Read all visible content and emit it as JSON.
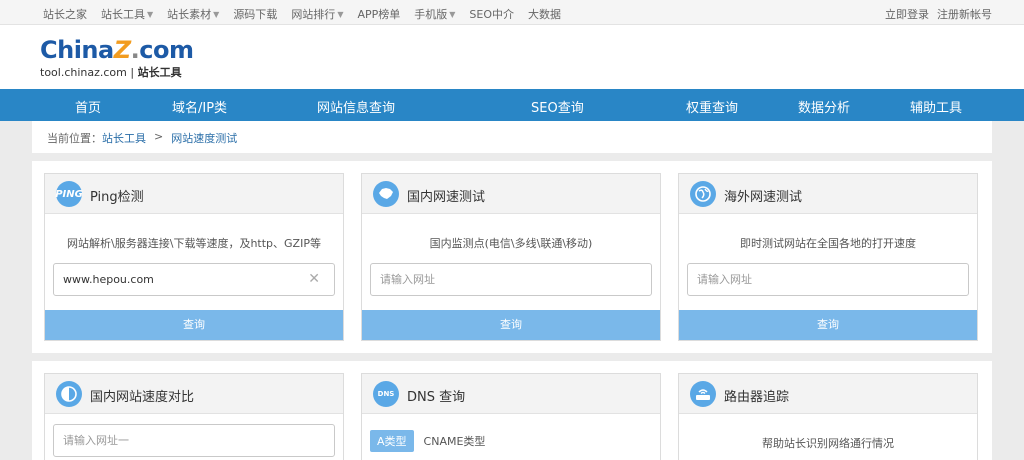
{
  "topbar": {
    "left": [
      {
        "label": "站长之家",
        "caret": false,
        "serif": true
      },
      {
        "label": "站长工具",
        "caret": true,
        "serif": true
      },
      {
        "label": "站长素材",
        "caret": true,
        "serif": true
      },
      {
        "label": "源码下载",
        "caret": false,
        "serif": true
      },
      {
        "label": "网站排行",
        "caret": true,
        "serif": true
      },
      {
        "label": "APP榜单",
        "caret": false,
        "serif": false
      },
      {
        "label": "手机版",
        "caret": true,
        "serif": true
      },
      {
        "label": "SEO中介",
        "caret": false,
        "serif": false
      },
      {
        "label": "大数据",
        "caret": false,
        "serif": true
      }
    ],
    "login": "立即登录",
    "register": "注册新帐号"
  },
  "logo": {
    "china": "China",
    "z": "Z",
    "dot": ".",
    "com": "com",
    "domain": "tool.chinaz.com",
    "divider": " | ",
    "tag": "站长工具"
  },
  "mainnav": [
    "首页",
    "域名/IP类",
    "网站信息查询",
    "SEO查询",
    "权重查询",
    "数据分析",
    "辅助工具"
  ],
  "breadcrumb": {
    "prefix": "当前位置：",
    "home": "站长工具",
    "sep": ">",
    "current": "网站速度测试"
  },
  "cards": [
    {
      "title": "Ping检测",
      "icon": "PING",
      "desc": "网站解析\\服务器连接\\下载等速度，及http、GZIP等",
      "input_value": "www.hepou.com",
      "button": "查询"
    },
    {
      "title": "国内网速测试",
      "icon": "china-map-icon",
      "desc": "国内监测点(电信\\多线\\联通\\移动)",
      "placeholder": "请输入网址",
      "button": "查询"
    },
    {
      "title": "海外网速测试",
      "icon": "globe-icon",
      "desc": "即时测试网站在全国各地的打开速度",
      "placeholder": "请输入网址",
      "button": "查询"
    },
    {
      "title": "国内网站速度对比",
      "icon": "half-circle-icon",
      "placeholder": "请输入网址一"
    },
    {
      "title": "DNS 查询",
      "icon": "DNS",
      "tab_a": "A类型",
      "tab_b": "CNAME类型"
    },
    {
      "title": "路由器追踪",
      "icon": "router-icon",
      "desc": "帮助站长识别网络通行情况"
    }
  ],
  "colors": {
    "nav": "#2986c6",
    "button": "#7ab8ea",
    "icon": "#5aa8e6",
    "brand_blue": "#1d5aa6",
    "brand_orange": "#f29c1f"
  }
}
